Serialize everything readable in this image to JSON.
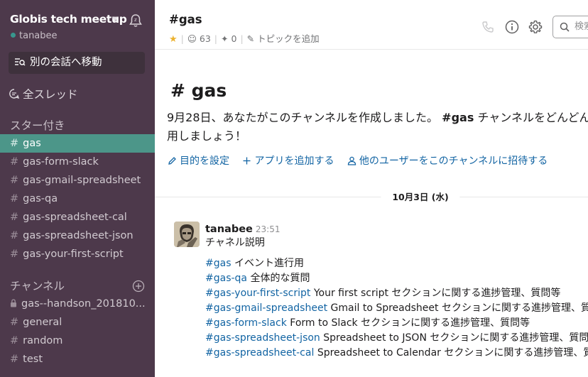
{
  "workspace": {
    "name": "Globis tech meetup",
    "user": "tanabee"
  },
  "sidebar": {
    "jump_label": "別の会話へ移動",
    "threads_label": "全スレッド",
    "starred_title": "スター付き",
    "starred": [
      {
        "name": "gas",
        "active": true
      },
      {
        "name": "gas-form-slack"
      },
      {
        "name": "gas-gmail-spreadsheet"
      },
      {
        "name": "gas-qa"
      },
      {
        "name": "gas-spreadsheet-cal"
      },
      {
        "name": "gas-spreadsheet-json"
      },
      {
        "name": "gas-your-first-script"
      }
    ],
    "channels_title": "チャンネル",
    "channels": [
      {
        "name": "gas--handson_201810...",
        "private": true
      },
      {
        "name": "general"
      },
      {
        "name": "random"
      },
      {
        "name": "test"
      }
    ]
  },
  "header": {
    "title": "#gas",
    "members": "63",
    "pins": "0",
    "topic": "トピックを追加",
    "search_placeholder": "検索"
  },
  "intro": {
    "title": "# gas",
    "text_before": "9月28日、あなたがこのチャンネルを作成しました。",
    "channel_bold": "#gas",
    "text_after": "チャンネルをどんどん活用しましょう！",
    "actions": {
      "purpose": "目的を設定",
      "add_app": "アプリを追加する",
      "invite": "他のユーザーをこのチャンネルに招待する"
    }
  },
  "date_divider": "10月3日 (水)",
  "message": {
    "author": "tanabee",
    "time": "23:51",
    "title": "チャネル説明",
    "lines": [
      {
        "link": "#gas",
        "text": "イベント進行用"
      },
      {
        "link": "#gas-qa",
        "text": "全体的な質問"
      },
      {
        "link": "#gas-your-first-script",
        "text": "Your first script セクションに関する進捗管理、質問等"
      },
      {
        "link": "#gas-gmail-spreadsheet",
        "text": "Gmail to Spreadsheet セクションに関する進捗管理、質問等"
      },
      {
        "link": "#gas-form-slack",
        "text": "Form to Slack セクションに関する進捗管理、質問等"
      },
      {
        "link": "#gas-spreadsheet-json",
        "text": "Spreadsheet to JSON セクションに関する進捗管理、質問等"
      },
      {
        "link": "#gas-spreadsheet-cal",
        "text": "Spreadsheet to Calendar セクションに関する進捗管理、質問等"
      }
    ]
  }
}
